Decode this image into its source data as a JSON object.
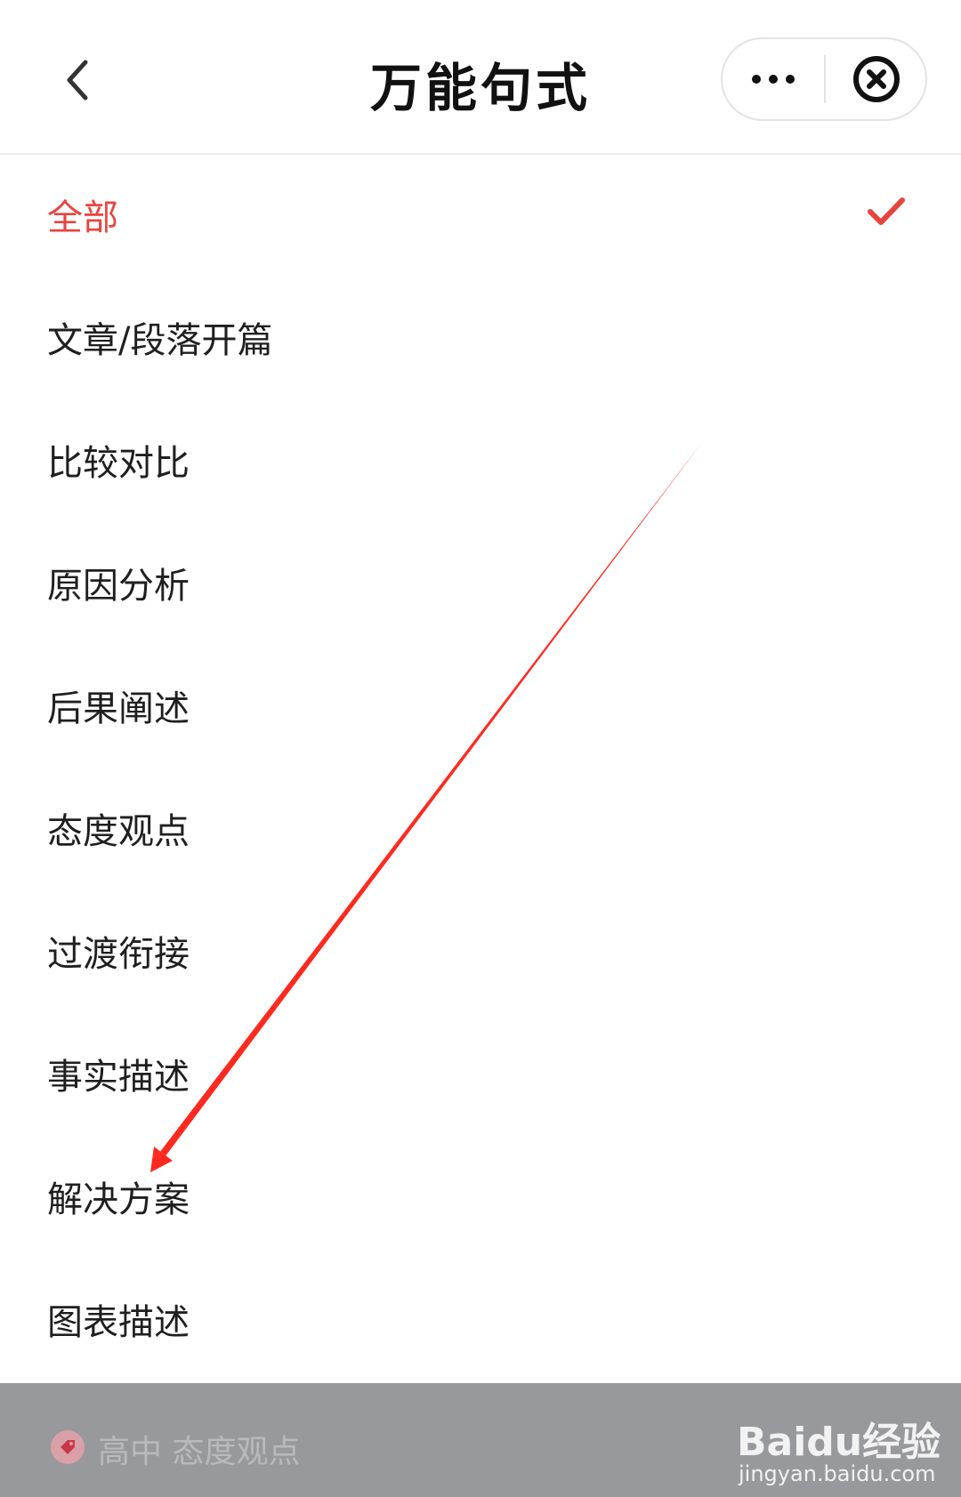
{
  "header": {
    "title": "万能句式",
    "back_icon": "chevron-left-icon",
    "more_icon": "more-dots-icon",
    "close_icon": "close-circle-icon"
  },
  "categories": [
    {
      "label": "全部",
      "selected": true
    },
    {
      "label": "文章/段落开篇",
      "selected": false
    },
    {
      "label": "比较对比",
      "selected": false
    },
    {
      "label": "原因分析",
      "selected": false
    },
    {
      "label": "后果阐述",
      "selected": false
    },
    {
      "label": "态度观点",
      "selected": false
    },
    {
      "label": "过渡衔接",
      "selected": false
    },
    {
      "label": "事实描述",
      "selected": false
    },
    {
      "label": "解决方案",
      "selected": false
    },
    {
      "label": "图表描述",
      "selected": false
    }
  ],
  "bottom_bar": {
    "text": "高中 态度观点",
    "icon": "tag-icon"
  },
  "watermark": {
    "brand": "Baidu经验",
    "url": "jingyan.baidu.com"
  },
  "colors": {
    "accent": "#e8443f",
    "annotation_arrow": "#ff2a1f",
    "bottom_bar": "#98999c"
  }
}
